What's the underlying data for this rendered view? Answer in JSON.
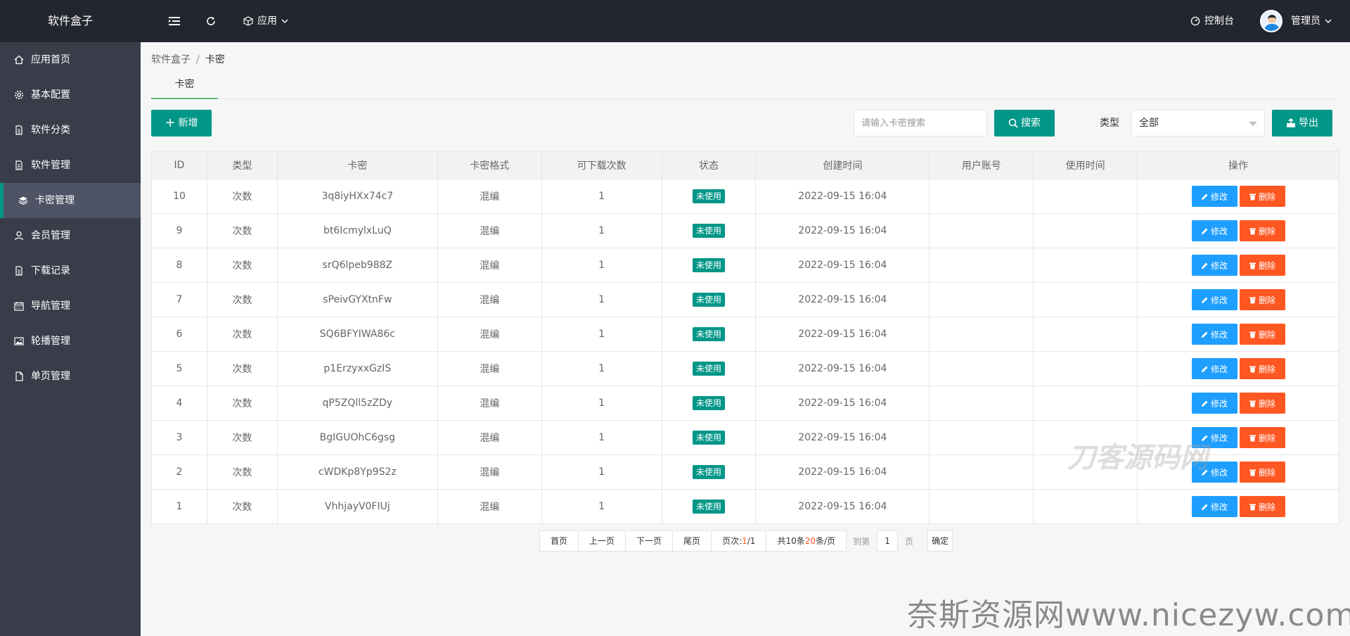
{
  "header": {
    "logo": "软件盒子",
    "app_menu": "应用",
    "console": "控制台",
    "user": "管理员"
  },
  "sidebar": {
    "items": [
      {
        "label": "应用首页",
        "icon": "home-icon"
      },
      {
        "label": "基本配置",
        "icon": "gear-icon"
      },
      {
        "label": "软件分类",
        "icon": "file-icon"
      },
      {
        "label": "软件管理",
        "icon": "file-icon"
      },
      {
        "label": "卡密管理",
        "icon": "layers-icon"
      },
      {
        "label": "会员管理",
        "icon": "user-icon"
      },
      {
        "label": "下载记录",
        "icon": "file-icon"
      },
      {
        "label": "导航管理",
        "icon": "calendar-icon"
      },
      {
        "label": "轮播管理",
        "icon": "image-icon"
      },
      {
        "label": "单页管理",
        "icon": "page-icon"
      }
    ],
    "active_index": 4
  },
  "breadcrumb": {
    "root": "软件盒子",
    "sep": "/",
    "current": "卡密"
  },
  "tab": {
    "label": "卡密"
  },
  "toolbar": {
    "add_label": "新增",
    "search_placeholder": "请输入卡密搜索",
    "search_label": "搜索",
    "type_label": "类型",
    "type_value": "全部",
    "export_label": "导出"
  },
  "table": {
    "headers": [
      "ID",
      "类型",
      "卡密",
      "卡密格式",
      "可下载次数",
      "状态",
      "创建时间",
      "用户账号",
      "使用时间",
      "操作"
    ],
    "rows": [
      {
        "id": "10",
        "type": "次数",
        "key": "3q8iyHXx74c7",
        "format": "混编",
        "count": "1",
        "status": "未使用",
        "created": "2022-09-15 16:04",
        "account": "",
        "used": ""
      },
      {
        "id": "9",
        "type": "次数",
        "key": "bt6IcmylxLuQ",
        "format": "混编",
        "count": "1",
        "status": "未使用",
        "created": "2022-09-15 16:04",
        "account": "",
        "used": ""
      },
      {
        "id": "8",
        "type": "次数",
        "key": "srQ6lpeb988Z",
        "format": "混编",
        "count": "1",
        "status": "未使用",
        "created": "2022-09-15 16:04",
        "account": "",
        "used": ""
      },
      {
        "id": "7",
        "type": "次数",
        "key": "sPeivGYXtnFw",
        "format": "混编",
        "count": "1",
        "status": "未使用",
        "created": "2022-09-15 16:04",
        "account": "",
        "used": ""
      },
      {
        "id": "6",
        "type": "次数",
        "key": "SQ6BFYIWA86c",
        "format": "混编",
        "count": "1",
        "status": "未使用",
        "created": "2022-09-15 16:04",
        "account": "",
        "used": ""
      },
      {
        "id": "5",
        "type": "次数",
        "key": "p1ErzyxxGzIS",
        "format": "混编",
        "count": "1",
        "status": "未使用",
        "created": "2022-09-15 16:04",
        "account": "",
        "used": ""
      },
      {
        "id": "4",
        "type": "次数",
        "key": "qP5ZQll5zZDy",
        "format": "混编",
        "count": "1",
        "status": "未使用",
        "created": "2022-09-15 16:04",
        "account": "",
        "used": ""
      },
      {
        "id": "3",
        "type": "次数",
        "key": "BgIGUOhC6gsg",
        "format": "混编",
        "count": "1",
        "status": "未使用",
        "created": "2022-09-15 16:04",
        "account": "",
        "used": ""
      },
      {
        "id": "2",
        "type": "次数",
        "key": "cWDKp8Yp9S2z",
        "format": "混编",
        "count": "1",
        "status": "未使用",
        "created": "2022-09-15 16:04",
        "account": "",
        "used": ""
      },
      {
        "id": "1",
        "type": "次数",
        "key": "VhhjayV0FIUj",
        "format": "混编",
        "count": "1",
        "status": "未使用",
        "created": "2022-09-15 16:04",
        "account": "",
        "used": ""
      }
    ],
    "edit_label": "修改",
    "delete_label": "删除"
  },
  "pager": {
    "first": "首页",
    "prev": "上一页",
    "next": "下一页",
    "last": "尾页",
    "page_prefix": "页次:",
    "page_current": "1",
    "page_sep": "/",
    "page_total": "1",
    "total_prefix": "共10条",
    "per_page": "20",
    "per_page_suffix": "条/页",
    "goto_label": "到第",
    "goto_value": "1",
    "page_unit": "页",
    "ok_label": "确定"
  },
  "watermarks": {
    "primary": "奈斯资源网www.nicezyw.com",
    "secondary": "刀客源码网"
  },
  "colors": {
    "header_bg": "#23262e",
    "sidebar_bg": "#393d49",
    "primary": "#009688",
    "edit": "#1e9fff",
    "delete": "#ff5722"
  }
}
